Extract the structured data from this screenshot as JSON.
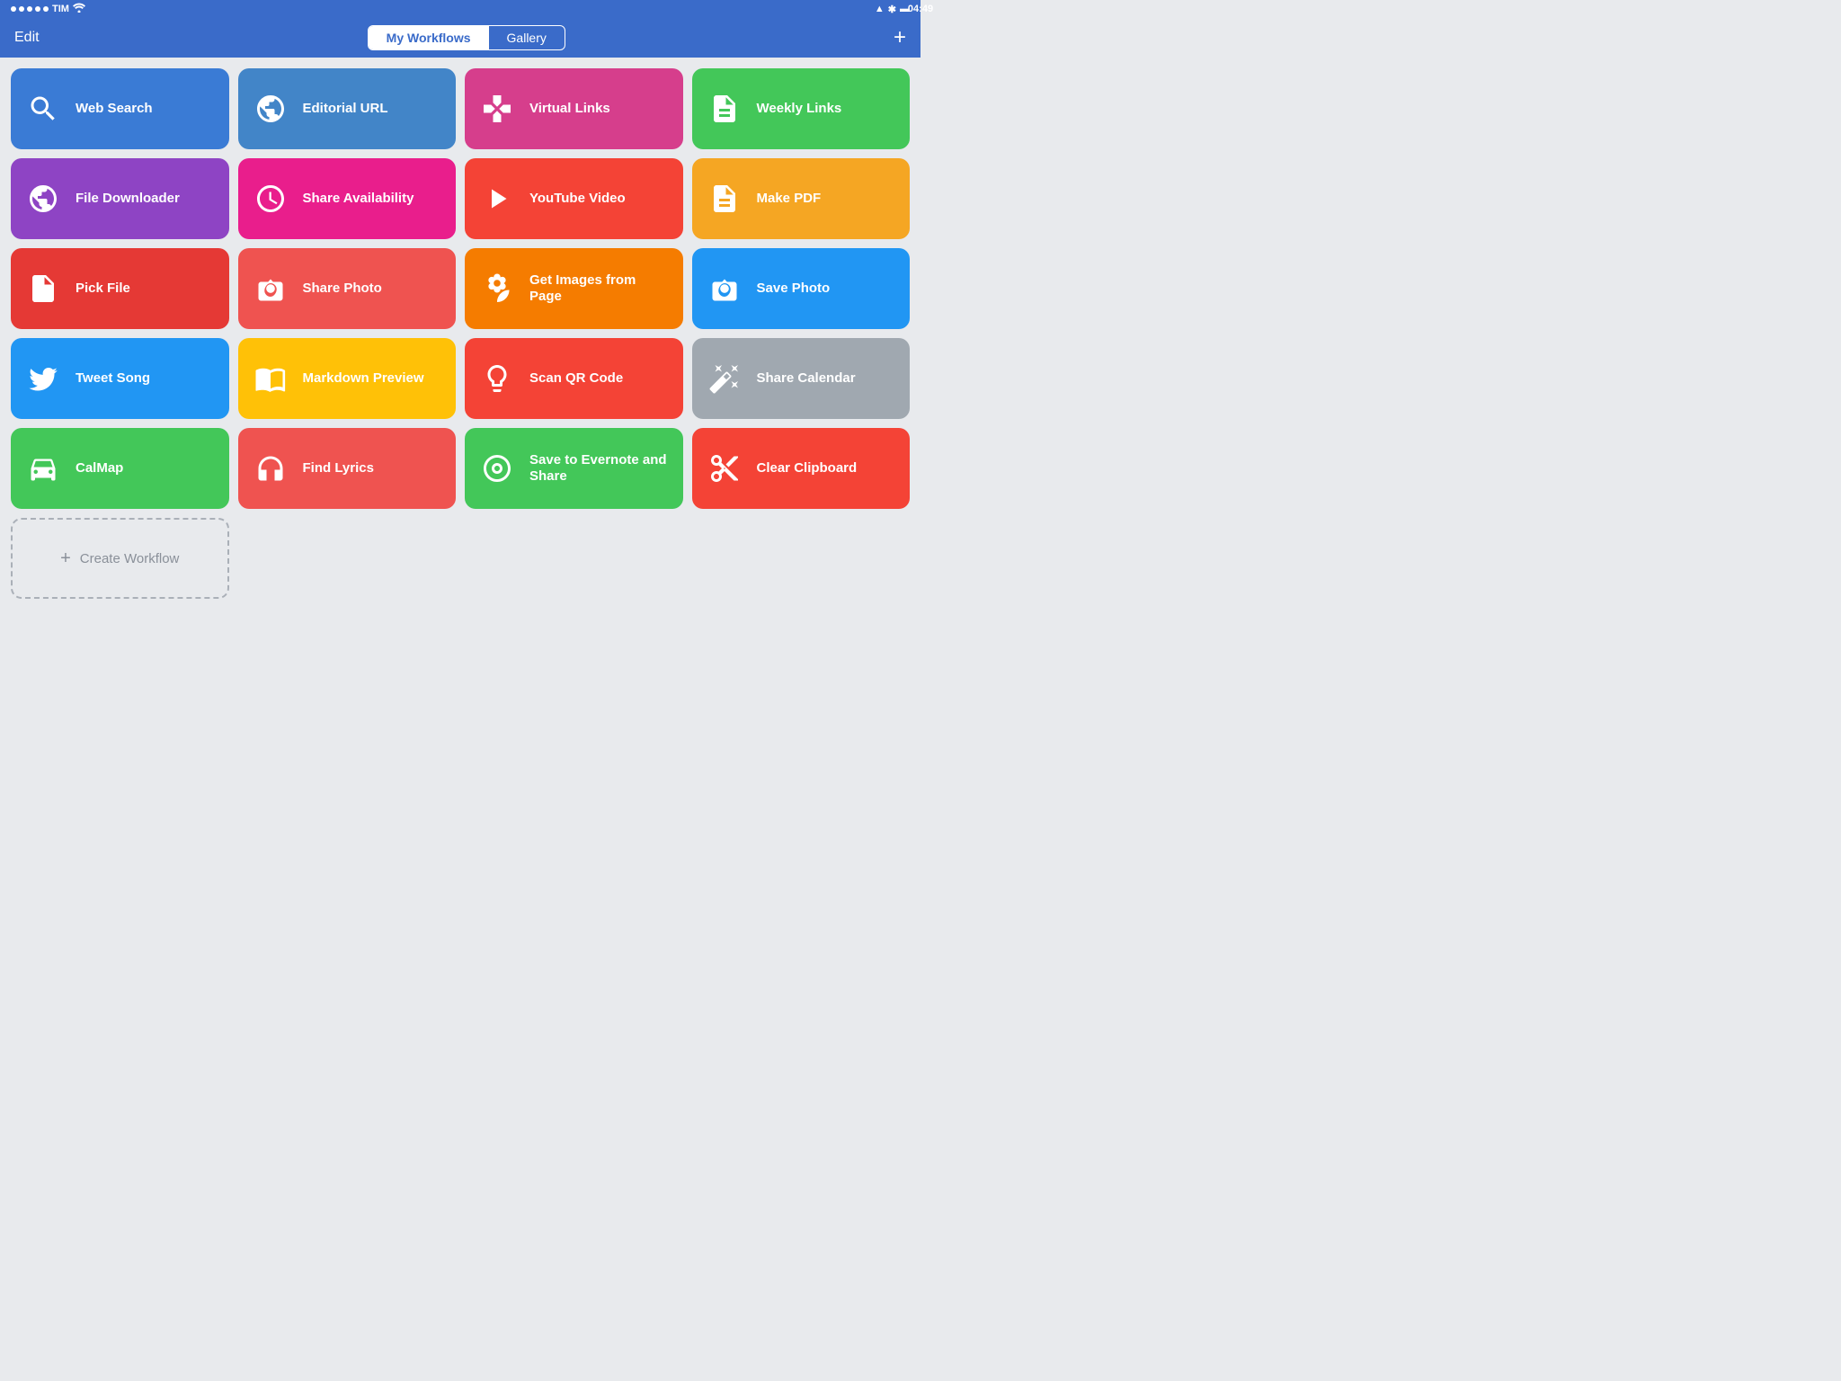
{
  "status_bar": {
    "carrier": "TIM",
    "time": "04:49",
    "wifi": true
  },
  "nav": {
    "edit_label": "Edit",
    "tab_my_workflows": "My Workflows",
    "tab_gallery": "Gallery",
    "plus_label": "+"
  },
  "workflows": [
    {
      "id": "web-search",
      "label": "Web Search",
      "color": "bg-blue",
      "icon": "search"
    },
    {
      "id": "editorial-url",
      "label": "Editorial URL",
      "color": "bg-blue2",
      "icon": "globe"
    },
    {
      "id": "virtual-links",
      "label": "Virtual Links",
      "color": "bg-magenta",
      "icon": "gamepad"
    },
    {
      "id": "weekly-links",
      "label": "Weekly Links",
      "color": "bg-green2",
      "icon": "doc"
    },
    {
      "id": "file-downloader",
      "label": "File Downloader",
      "color": "bg-purple",
      "icon": "globe2"
    },
    {
      "id": "share-availability",
      "label": "Share Availability",
      "color": "bg-pink",
      "icon": "clock"
    },
    {
      "id": "youtube-video",
      "label": "YouTube Video",
      "color": "bg-red2",
      "icon": "play"
    },
    {
      "id": "make-pdf",
      "label": "Make PDF",
      "color": "bg-orange",
      "icon": "doc2"
    },
    {
      "id": "pick-file",
      "label": "Pick File",
      "color": "bg-red",
      "icon": "filedoc"
    },
    {
      "id": "share-photo",
      "label": "Share Photo",
      "color": "bg-coral",
      "icon": "camera"
    },
    {
      "id": "get-images",
      "label": "Get Images from Page",
      "color": "bg-orange2",
      "icon": "flower"
    },
    {
      "id": "save-photo",
      "label": "Save Photo",
      "color": "bg-dodger",
      "icon": "camera2"
    },
    {
      "id": "tweet-song",
      "label": "Tweet Song",
      "color": "bg-dodger",
      "icon": "twitter"
    },
    {
      "id": "markdown-preview",
      "label": "Markdown Preview",
      "color": "bg-yellow",
      "icon": "book"
    },
    {
      "id": "scan-qr",
      "label": "Scan QR Code",
      "color": "bg-red2",
      "icon": "lightbulb"
    },
    {
      "id": "share-calendar",
      "label": "Share Calendar",
      "color": "bg-gray",
      "icon": "wand"
    },
    {
      "id": "calmap",
      "label": "CalMap",
      "color": "bg-green2",
      "icon": "car"
    },
    {
      "id": "find-lyrics",
      "label": "Find Lyrics",
      "color": "bg-coral",
      "icon": "headphones"
    },
    {
      "id": "save-evernote",
      "label": "Save to Evernote and Share",
      "color": "bg-green2",
      "icon": "target"
    },
    {
      "id": "clear-clipboard",
      "label": "Clear Clipboard",
      "color": "bg-red2",
      "icon": "scissors"
    }
  ],
  "create_workflow": {
    "label": "Create Workflow",
    "icon": "+"
  }
}
